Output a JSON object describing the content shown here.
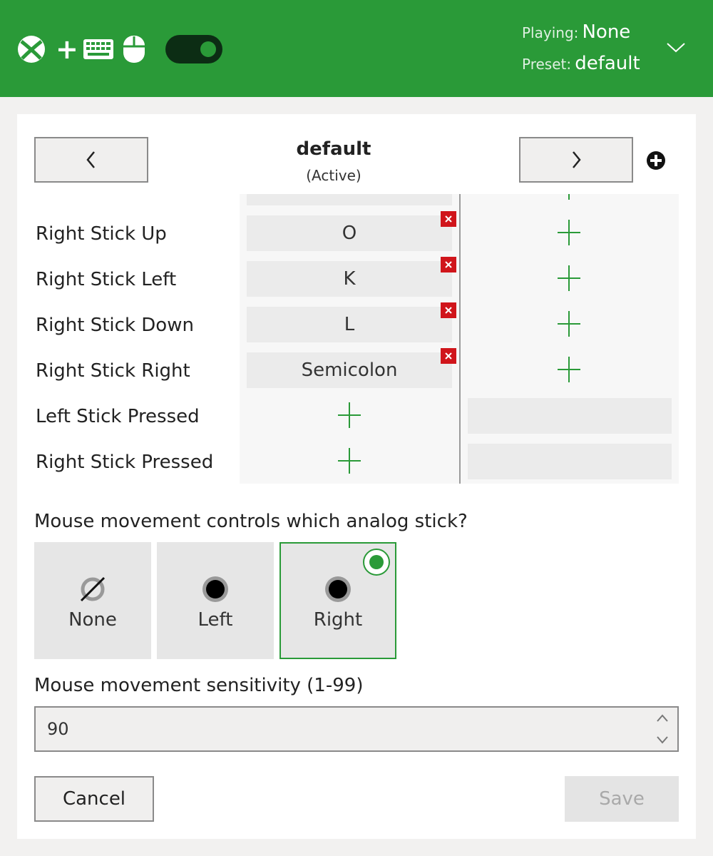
{
  "header": {
    "toggle_on": true,
    "playing_label": "Playing:",
    "playing_value": "None",
    "preset_label": "Preset:",
    "preset_value": "default",
    "accent_color": "#2a9a38"
  },
  "preset_nav": {
    "name": "default",
    "state": "(Active)"
  },
  "mappings": [
    {
      "label": "Right Stick Up",
      "key": "O"
    },
    {
      "label": "Right Stick Left",
      "key": "K"
    },
    {
      "label": "Right Stick Down",
      "key": "L"
    },
    {
      "label": "Right Stick Right",
      "key": "Semicolon"
    },
    {
      "label": "Left Stick Pressed",
      "key": ""
    },
    {
      "label": "Right Stick Pressed",
      "key": ""
    }
  ],
  "analog": {
    "question": "Mouse movement controls which analog stick?",
    "options": [
      {
        "label": "None",
        "icon": "no-stick-icon"
      },
      {
        "label": "Left",
        "icon": "stick-icon"
      },
      {
        "label": "Right",
        "icon": "stick-icon"
      }
    ],
    "selected": "Right"
  },
  "sensitivity": {
    "label": "Mouse movement sensitivity (1-99)",
    "value": "90"
  },
  "footer": {
    "cancel_label": "Cancel",
    "save_label": "Save"
  }
}
